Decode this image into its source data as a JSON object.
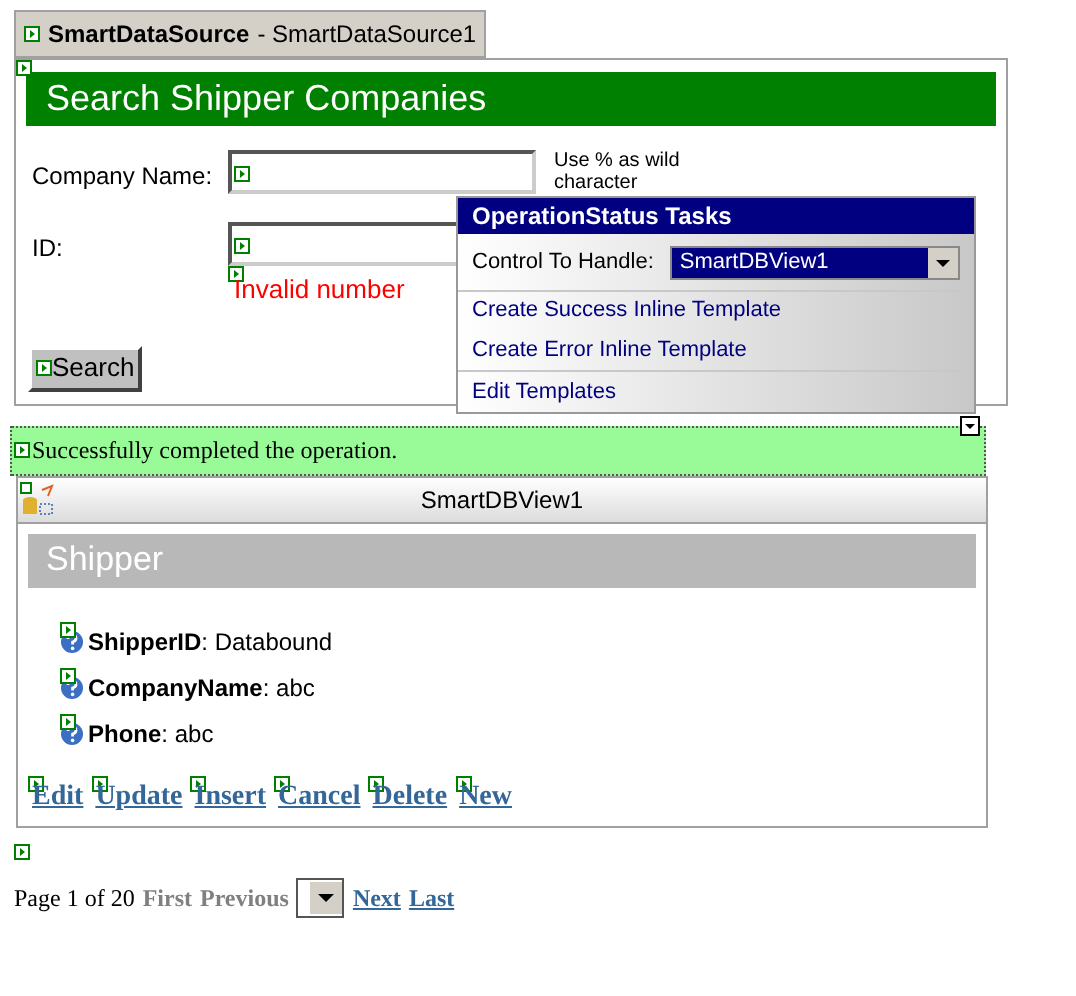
{
  "tab": {
    "title": "SmartDataSource",
    "subtitle": "- SmartDataSource1"
  },
  "search_panel": {
    "title": "Search Shipper Companies",
    "fields": [
      {
        "label": "Company Name:",
        "hint": "Use % as wild character"
      },
      {
        "label": "ID:",
        "error": "Invalid number"
      }
    ],
    "button": "Search"
  },
  "tasks_popup": {
    "title": "OperationStatus Tasks",
    "control_label": "Control To Handle:",
    "control_value": "SmartDBView1",
    "actions": [
      {
        "label": "Create Success Inline Template",
        "separated": false
      },
      {
        "label": "Create Error Inline Template",
        "separated": false
      },
      {
        "label": "Edit Templates",
        "separated": true
      }
    ]
  },
  "status_message": "Successfully completed the operation.",
  "db_view": {
    "title": "SmartDBView1",
    "heading": "Shipper",
    "fields": [
      "**ShipperID**: Databound",
      "**CompanyName**: abc",
      "**Phone**: abc"
    ],
    "commands": [
      "Edit",
      "Update",
      "Insert",
      "Cancel",
      "Delete",
      "New"
    ]
  },
  "pager": {
    "summary": "Page 1 of 20",
    "links": [
      {
        "label": "First",
        "disabled": true
      },
      {
        "label": "Previous",
        "disabled": true
      },
      {
        "label": "Next",
        "disabled": false
      },
      {
        "label": "Last",
        "disabled": false
      }
    ]
  }
}
